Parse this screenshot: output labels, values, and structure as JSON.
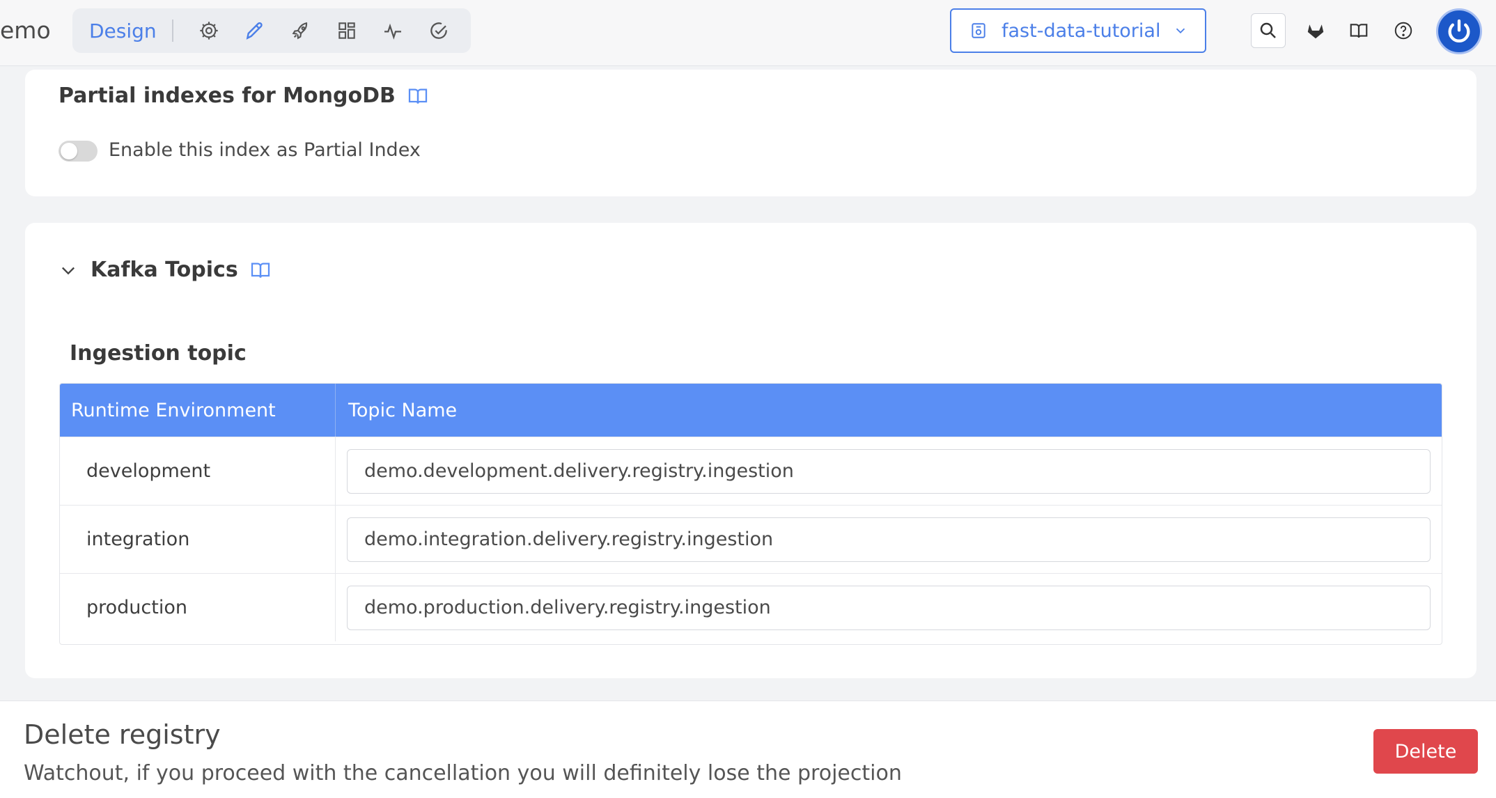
{
  "topbar": {
    "project_name": "emo",
    "active_section": "Design",
    "nav_icons": [
      "gear-icon",
      "pencil-icon",
      "rocket-icon",
      "dashboard-icon",
      "pulse-icon",
      "check-circle-icon"
    ],
    "branch": {
      "name": "fast-data-tutorial",
      "icon": "branch-icon"
    },
    "right_icons": [
      "search-icon",
      "gitlab-icon",
      "book-icon",
      "help-icon"
    ],
    "accent": "#4b7fe8"
  },
  "partial_index": {
    "title": "Partial indexes for MongoDB",
    "toggle_label": "Enable this index as Partial Index",
    "enabled": false
  },
  "kafka": {
    "title": "Kafka Topics",
    "subtitle": "Ingestion topic",
    "columns": [
      "Runtime Environment",
      "Topic Name"
    ],
    "rows": [
      {
        "env": "development",
        "topic": "demo.development.delivery.registry.ingestion"
      },
      {
        "env": "integration",
        "topic": "demo.integration.delivery.registry.ingestion"
      },
      {
        "env": "production",
        "topic": "demo.production.delivery.registry.ingestion"
      }
    ],
    "header_color": "#5b8ff5"
  },
  "danger_zone": {
    "title": "Delete registry",
    "description": "Watchout, if you proceed with the cancellation you will definitely lose the projection",
    "delete_label": "Delete",
    "delete_color": "#e0474c"
  }
}
